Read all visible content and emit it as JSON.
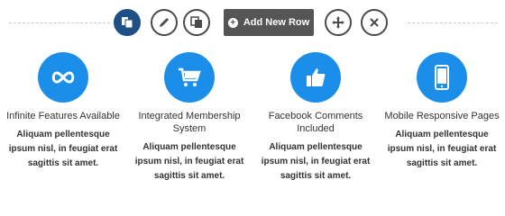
{
  "toolbar": {
    "add_row_label": "Add New Row",
    "icons": [
      "copy-icon",
      "edit-icon",
      "duplicate-icon",
      "move-icon",
      "close-icon"
    ]
  },
  "colors": {
    "accent": "#1a8ee8",
    "primary_button": "#1f4f87",
    "add_row_bg": "#555555"
  },
  "features": [
    {
      "icon": "infinity-icon",
      "title": "Infinite Features Available",
      "desc": "Aliquam pellentesque ipsum nisl, in feugiat erat sagittis sit amet."
    },
    {
      "icon": "cart-icon",
      "title": "Integrated Membership System",
      "desc": "Aliquam pellentesque ipsum nisl, in feugiat erat sagittis sit amet."
    },
    {
      "icon": "thumbs-up-icon",
      "title": "Facebook Comments Included",
      "desc": "Aliquam pellentesque ipsum nisl, in feugiat erat sagittis sit amet."
    },
    {
      "icon": "mobile-icon",
      "title": "Mobile Responsive Pages",
      "desc": "Aliquam pellentesque ipsum nisl, in feugiat erat sagittis sit amet."
    }
  ]
}
